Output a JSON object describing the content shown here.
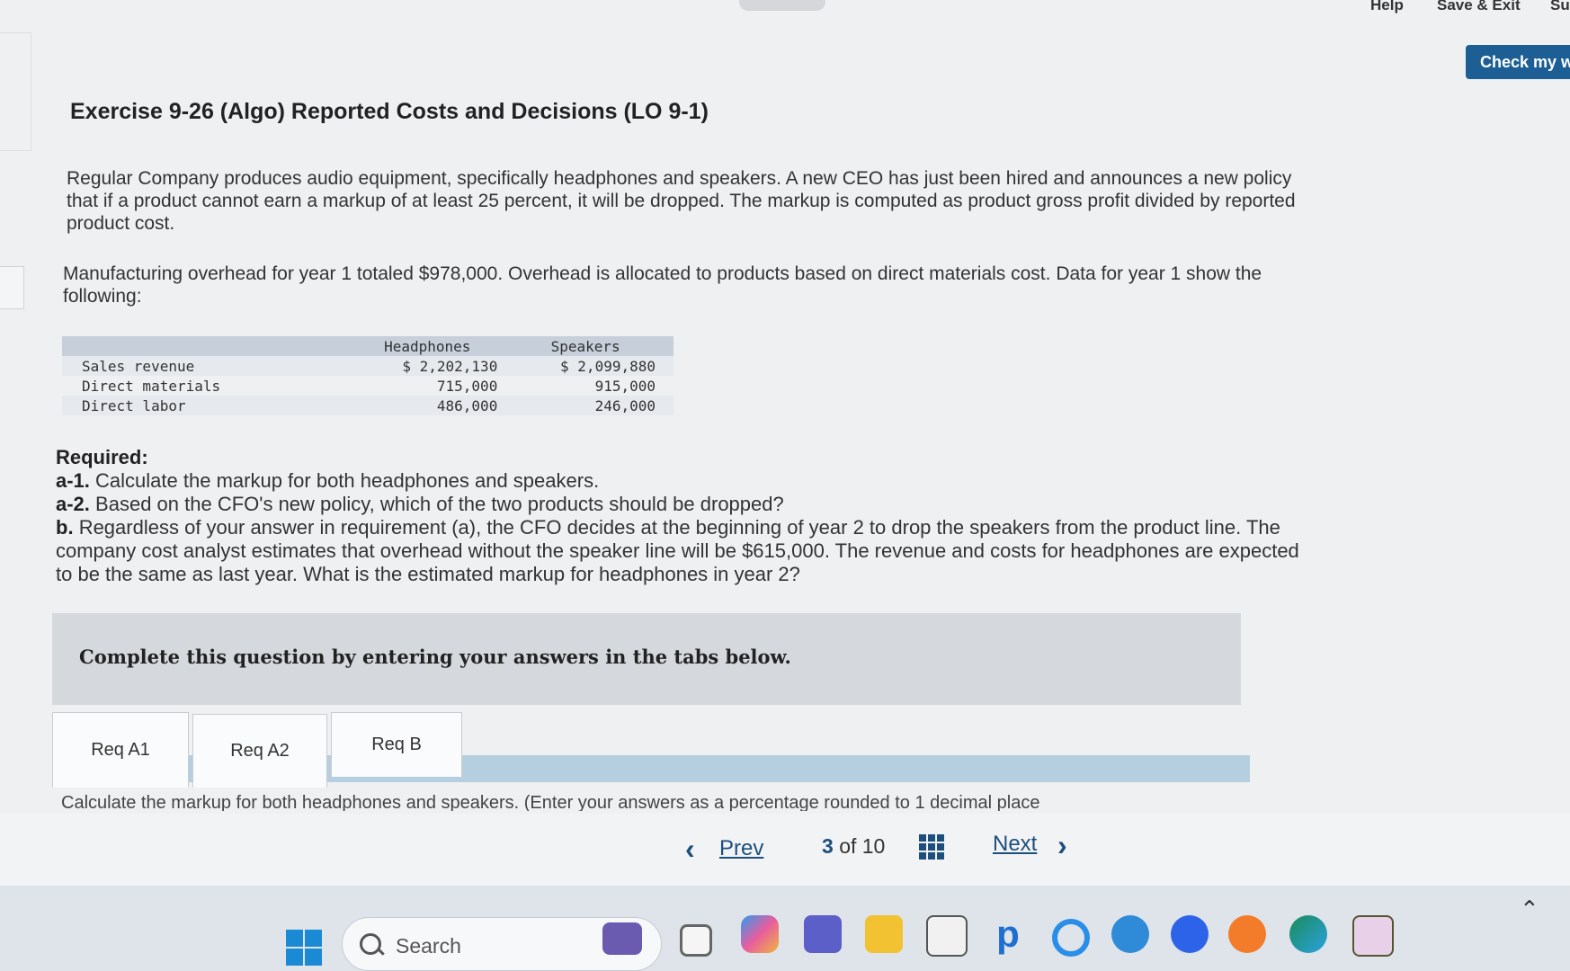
{
  "header": {
    "help_label": "Help",
    "save_exit_label": "Save & Exit",
    "submit_label": "Su",
    "check_label": "Check my w"
  },
  "exercise": {
    "title": "Exercise 9-26 (Algo) Reported Costs and Decisions (LO 9-1)",
    "paragraph1": "Regular Company produces audio equipment, specifically headphones and speakers. A new CEO has just been hired and announces a new policy that if a product cannot earn a markup of at least 25 percent, it will be dropped. The markup is computed as product gross profit divided by reported product cost.",
    "paragraph2": "Manufacturing overhead for year 1 totaled $978,000. Overhead is allocated to products based on direct materials cost. Data for year 1 show the following:"
  },
  "table": {
    "columns": [
      "Headphones",
      "Speakers"
    ],
    "rows": [
      {
        "label": "Sales revenue",
        "headphones": "$ 2,202,130",
        "speakers": "$ 2,099,880"
      },
      {
        "label": "Direct materials",
        "headphones": "715,000",
        "speakers": "915,000"
      },
      {
        "label": "Direct labor",
        "headphones": "486,000",
        "speakers": "246,000"
      }
    ]
  },
  "required": {
    "heading": "Required:",
    "a1_tag": "a-1.",
    "a1_text": "Calculate the markup for both headphones and speakers.",
    "a2_tag": "a-2.",
    "a2_text": "Based on the CFO's new policy, which of the two products should be dropped?",
    "b_tag": "b.",
    "b_text": "Regardless of your answer in requirement (a), the CFO decides at the beginning of year 2 to drop the speakers from the product line. The company cost analyst estimates that overhead without the speaker line will be $615,000. The revenue and costs for headphones are expected to be the same as last year. What is the estimated markup for headphones in year 2?"
  },
  "panel": {
    "text": "Complete this question by entering your answers in the tabs below."
  },
  "tabs": [
    "Req A1",
    "Req A2",
    "Req B"
  ],
  "instruction": "Calculate the markup for both headphones and speakers. (Enter your answers as a percentage rounded to 1 decimal place",
  "navigation": {
    "prev_label": "Prev",
    "next_label": "Next",
    "current": "3",
    "of_label": "of 10"
  },
  "taskbar": {
    "search_label": "Search"
  },
  "colors": {
    "accent": "#1d5f95",
    "nav_text": "#1d4f7e",
    "table_header": "#c6cfda",
    "tab_strip": "#b5cfe0"
  }
}
